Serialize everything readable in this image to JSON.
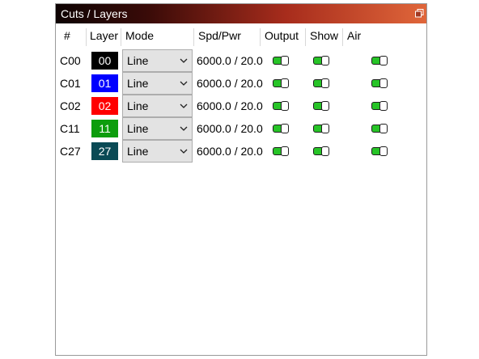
{
  "window": {
    "title": "Cuts / Layers",
    "restore_icon": "restore-window-icon"
  },
  "columns": {
    "num": "#",
    "layer": "Layer",
    "mode": "Mode",
    "spdpwr": "Spd/Pwr",
    "output": "Output",
    "show": "Show",
    "air": "Air"
  },
  "rows": [
    {
      "id": "C00",
      "layer": "00",
      "color": "#000000",
      "mode": "Line",
      "spdpwr": "6000.0 / 20.0",
      "output": true,
      "show": true,
      "air": true
    },
    {
      "id": "C01",
      "layer": "01",
      "color": "#0000ff",
      "mode": "Line",
      "spdpwr": "6000.0 / 20.0",
      "output": true,
      "show": true,
      "air": true
    },
    {
      "id": "C02",
      "layer": "02",
      "color": "#ff0000",
      "mode": "Line",
      "spdpwr": "6000.0 / 20.0",
      "output": true,
      "show": true,
      "air": true
    },
    {
      "id": "C11",
      "layer": "11",
      "color": "#0d9d0d",
      "mode": "Line",
      "spdpwr": "6000.0 / 20.0",
      "output": true,
      "show": true,
      "air": true
    },
    {
      "id": "C27",
      "layer": "27",
      "color": "#0a4a55",
      "mode": "Line",
      "spdpwr": "6000.0 / 20.0",
      "output": true,
      "show": true,
      "air": true
    }
  ],
  "colors": {
    "toggle_on": "#27c427"
  }
}
